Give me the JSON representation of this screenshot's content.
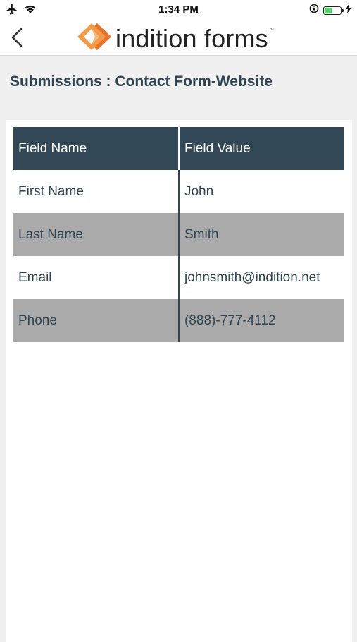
{
  "status_bar": {
    "time": "1:34 PM",
    "battery_level": 0.4,
    "battery_color": "#4cd964"
  },
  "nav": {
    "brand": "indition forms",
    "brand_tm": "™",
    "logo_colors": [
      "#f29a45",
      "#e8742a",
      "#f7b67a"
    ]
  },
  "page": {
    "title": "Submissions : Contact Form-Website"
  },
  "table": {
    "headers": [
      "Field Name",
      "Field Value"
    ],
    "rows": [
      [
        "First Name",
        "John"
      ],
      [
        "Last Name",
        "Smith"
      ],
      [
        "Email",
        "johnsmith@indition.net"
      ],
      [
        "Phone",
        "(888)-777-4112"
      ]
    ],
    "header_color": "#334856",
    "alt_row_color": "#aaaaaa"
  }
}
